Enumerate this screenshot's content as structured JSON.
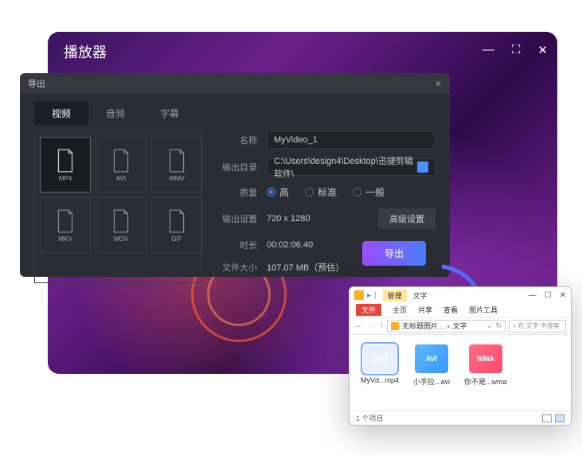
{
  "player": {
    "title": "播放器"
  },
  "export": {
    "title": "导出",
    "tabs": {
      "video": "视频",
      "audio": "音频",
      "subtitle": "字幕"
    },
    "formats": [
      "MP4",
      "AVI",
      "WMV",
      "MKV",
      "MOV",
      "GIF"
    ],
    "fields": {
      "name_label": "名称",
      "name_value": "MyVideo_1",
      "dir_label": "输出目录",
      "dir_value": "C:\\Users\\design4\\Desktop\\迅捷剪辑软件\\",
      "quality_label": "质量",
      "quality_options": {
        "high": "高",
        "standard": "标准",
        "normal": "一般"
      },
      "output_label": "输出设置",
      "output_value": "720 x 1280",
      "adv_btn": "高级设置",
      "duration_label": "时长",
      "duration_value": "00:02:06.40",
      "size_label": "文件大小",
      "size_value": "107.07 MB（预估）"
    },
    "export_btn": "导出"
  },
  "explorer": {
    "ribbon_tabs": {
      "manage": "管理",
      "text": "文字"
    },
    "menu": {
      "file": "文件",
      "home": "主页",
      "share": "共享",
      "view": "查看",
      "tools": "图片工具"
    },
    "breadcrumb": {
      "a": "无标题图片...",
      "b": "文字"
    },
    "search_placeholder": "在 文字 中搜索",
    "files": [
      {
        "name": "MyVd...mp4",
        "type": "MP4"
      },
      {
        "name": "小手拉...avi",
        "type": "AVI"
      },
      {
        "name": "你不是...wma",
        "type": "WMA"
      }
    ],
    "status": "1 个项目"
  }
}
